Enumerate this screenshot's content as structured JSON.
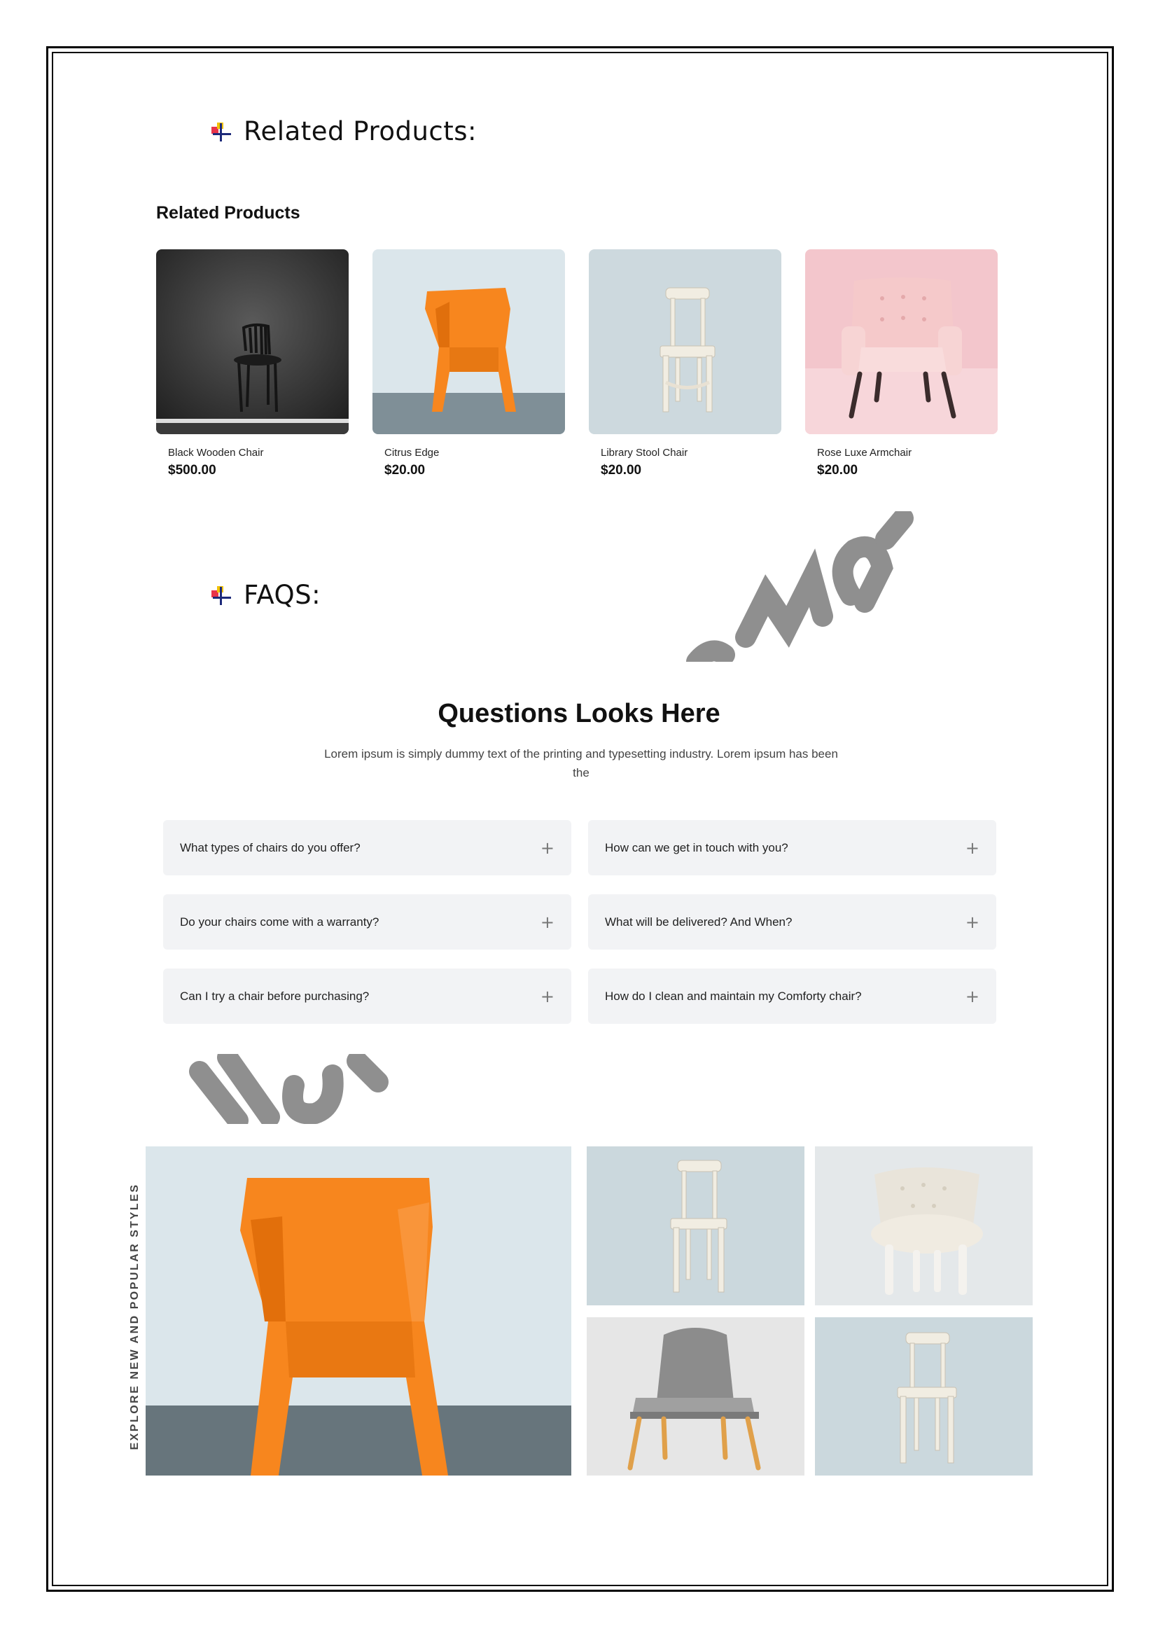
{
  "related_heading": "Related Products:",
  "related_products": {
    "title": "Related Products",
    "items": [
      {
        "name": "Black Wooden Chair",
        "price": "$500.00"
      },
      {
        "name": "Citrus Edge",
        "price": "$20.00"
      },
      {
        "name": "Library Stool Chair",
        "price": "$20.00"
      },
      {
        "name": "Rose Luxe Armchair",
        "price": "$20.00"
      }
    ]
  },
  "faqs_heading": "FAQS:",
  "faq": {
    "title": "Questions Looks Here",
    "subtitle_line1": "Lorem ipsum is simply dummy text of the printing and typesetting industry. Lorem ipsum has been",
    "subtitle_line2": "the",
    "questions": [
      "What types of chairs do you offer?",
      "How can we get in touch with you?",
      "Do your chairs come with a warranty?",
      "What will be delivered? And When?",
      "Can I try a chair before purchasing?",
      "How do I clean and maintain my Comforty chair?"
    ],
    "expand_symbol": "+"
  },
  "gallery": {
    "side_text": "EXPLORE NEW AND POPULAR STYLES"
  },
  "colors": {
    "orange": "#f7861e",
    "pink": "#f3c6cc",
    "watermark": "#8f8f8f"
  }
}
